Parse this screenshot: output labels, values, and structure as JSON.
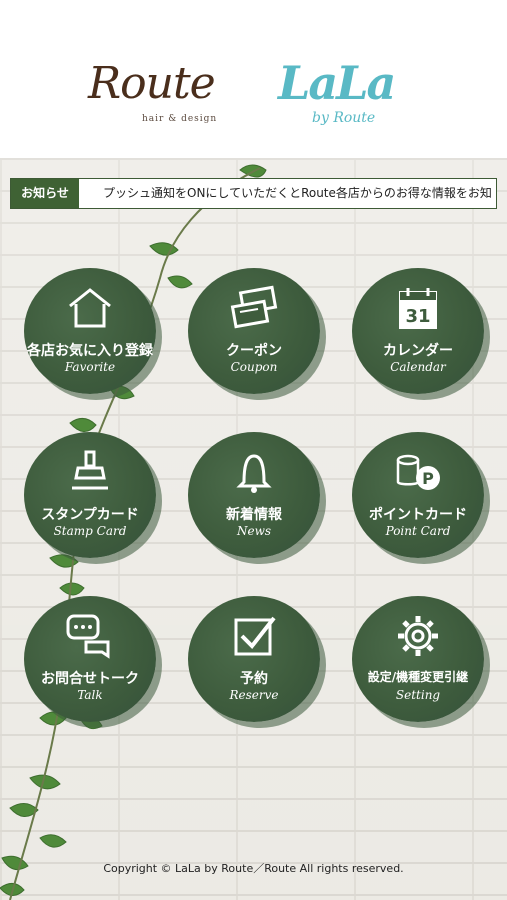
{
  "brand": {
    "route_logo": "Route",
    "route_tagline": "hair & design",
    "lala_logo": "LaLa",
    "lala_tagline": "by Route"
  },
  "notice": {
    "label": "お知らせ",
    "text": "プッシュ通知をONにしていただくとRoute各店からのお得な情報をお知"
  },
  "menu": [
    {
      "jp": "各店お気に入り登録",
      "en": "Favorite",
      "icon": "house-icon"
    },
    {
      "jp": "クーポン",
      "en": "Coupon",
      "icon": "coupon-icon"
    },
    {
      "jp": "カレンダー",
      "en": "Calendar",
      "icon": "calendar-icon",
      "badge": "31"
    },
    {
      "jp": "スタンプカード",
      "en": "Stamp Card",
      "icon": "stamp-icon"
    },
    {
      "jp": "新着情報",
      "en": "News",
      "icon": "bell-icon"
    },
    {
      "jp": "ポイントカード",
      "en": "Point Card",
      "icon": "coins-icon",
      "badge": "P"
    },
    {
      "jp": "お問合せトーク",
      "en": "Talk",
      "icon": "chat-icon"
    },
    {
      "jp": "予約",
      "en": "Reserve",
      "icon": "checkbox-icon"
    },
    {
      "jp": "設定/機種変更引継",
      "en": "Setting",
      "icon": "gear-icon"
    }
  ],
  "footer": {
    "copyright": "Copyright © LaLa by Route／Route All rights reserved."
  },
  "colors": {
    "accent": "#3f6234",
    "disc": "#3e5c3d",
    "lala": "#59b9c5",
    "route": "#4a2e1c"
  }
}
